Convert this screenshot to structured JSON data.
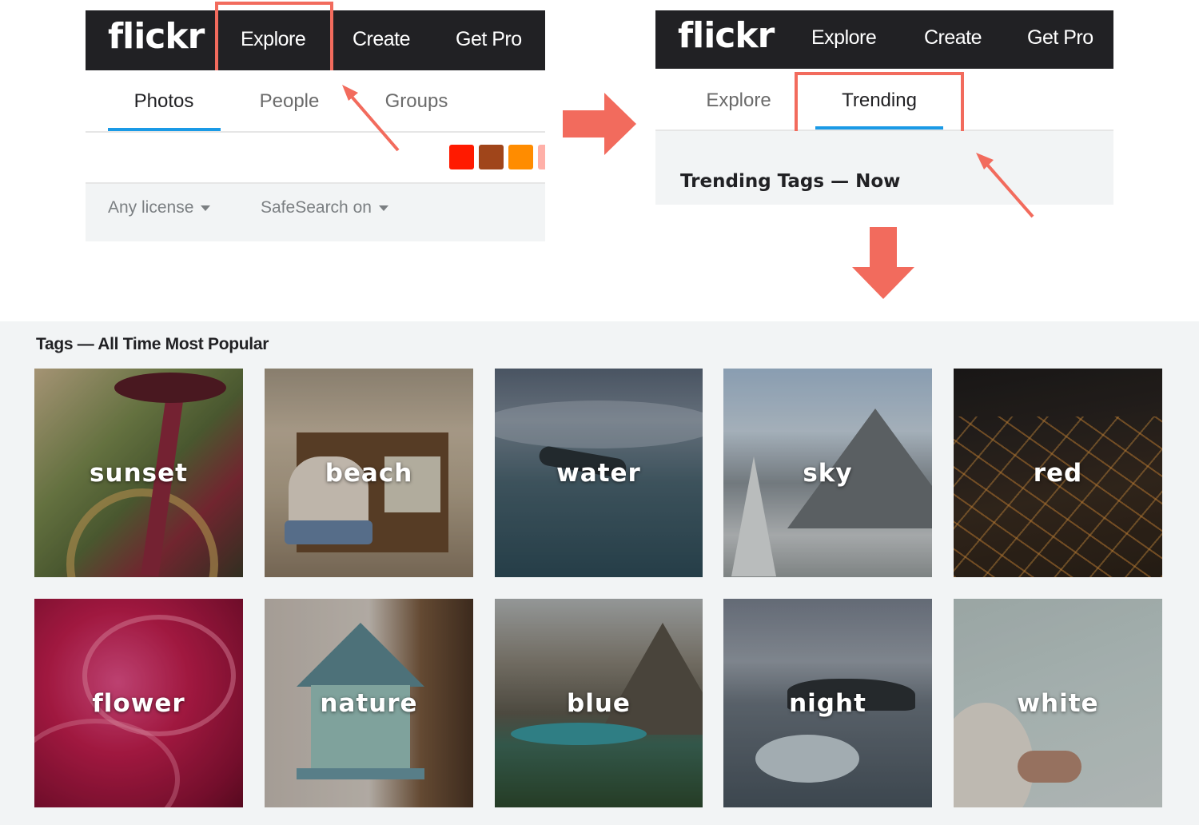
{
  "left_panel": {
    "logo": "flickr",
    "nav": [
      "Explore",
      "Create",
      "Get Pro"
    ],
    "tabs": [
      "Photos",
      "People",
      "Groups"
    ],
    "filters": [
      "Any license",
      "SafeSearch on"
    ],
    "swatch_colors": [
      "#ff1a00",
      "#a0451a",
      "#ff8c00",
      "#ffb0a8"
    ]
  },
  "right_panel": {
    "logo": "flickr",
    "nav": [
      "Explore",
      "Create",
      "Get Pro"
    ],
    "tabs": [
      "Explore",
      "Trending"
    ],
    "trending_title": "Trending Tags — Now"
  },
  "tags_section": {
    "heading": "Tags — All Time Most Popular",
    "tags": [
      "sunset",
      "beach",
      "water",
      "sky",
      "red",
      "flower",
      "nature",
      "blue",
      "night",
      "white"
    ]
  },
  "colors": {
    "accent": "#f26b5d",
    "tab_underline": "#1a9ae6",
    "bar": "#212124"
  }
}
